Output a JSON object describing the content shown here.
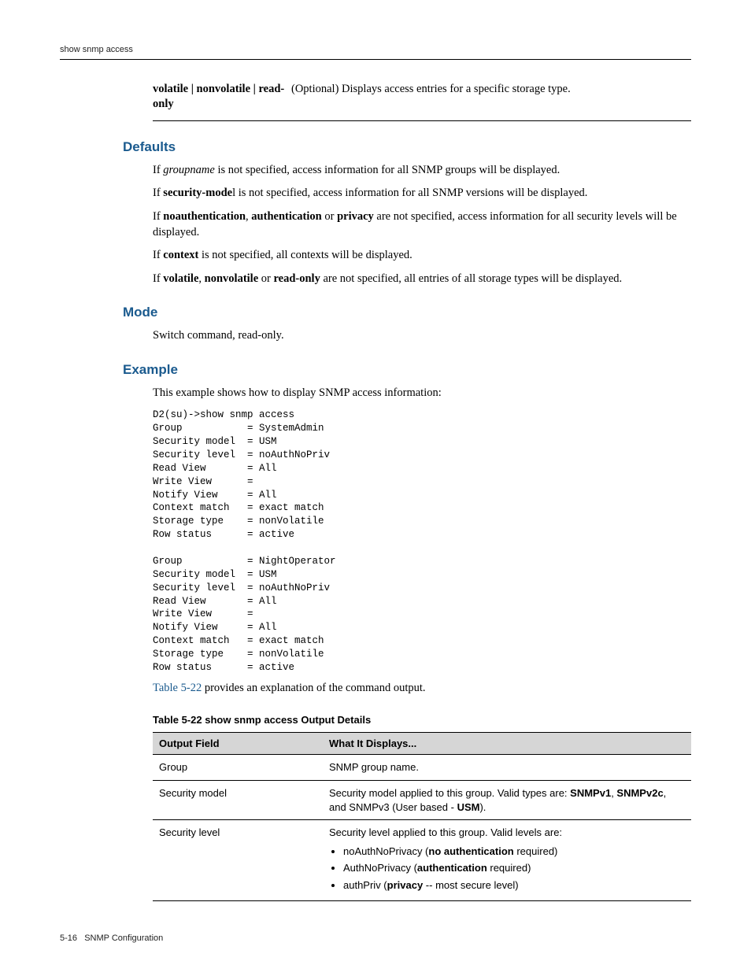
{
  "runningHead": "show snmp access",
  "param": {
    "name": "volatile | nonvolatile | read-only",
    "desc": "(Optional) Displays access entries for a specific storage type."
  },
  "sections": {
    "defaults": {
      "title": "Defaults",
      "p1a": "If ",
      "p1b": "groupname",
      "p1c": " is not specified, access information for all SNMP groups will be displayed.",
      "p2a": "If ",
      "p2b": "security-mode",
      "p2c": "l is not specified, access information for all SNMP versions will be displayed.",
      "p3a": "If ",
      "p3b": "noauthentication",
      "p3c": ", ",
      "p3d": "authentication",
      "p3e": " or ",
      "p3f": "privacy",
      "p3g": " are not specified, access information for all security levels will be displayed.",
      "p4a": "If ",
      "p4b": "context",
      "p4c": " is not specified, all contexts will be displayed.",
      "p5a": "If ",
      "p5b": "volatile",
      "p5c": ", ",
      "p5d": "nonvolatile",
      "p5e": " or ",
      "p5f": "read-only",
      "p5g": " are not specified, all entries of all storage types will be displayed."
    },
    "mode": {
      "title": "Mode",
      "p": "Switch command, read-only."
    },
    "example": {
      "title": "Example",
      "intro": "This example shows how to display SNMP access information:",
      "code": "D2(su)->show snmp access\nGroup           = SystemAdmin\nSecurity model  = USM\nSecurity level  = noAuthNoPriv\nRead View       = All\nWrite View      =\nNotify View     = All\nContext match   = exact match\nStorage type    = nonVolatile\nRow status      = active\n\nGroup           = NightOperator\nSecurity model  = USM\nSecurity level  = noAuthNoPriv\nRead View       = All\nWrite View      =\nNotify View     = All\nContext match   = exact match\nStorage type    = nonVolatile\nRow status      = active",
      "outroA": "Table 5-22",
      "outroB": " provides an explanation of the command output."
    }
  },
  "table": {
    "caption": "Table 5-22   show snmp access Output Details",
    "col1": "Output Field",
    "col2": "What It Displays...",
    "r1f": "Group",
    "r1d": "SNMP group name.",
    "r2f": "Security model",
    "r2a": "Security model applied to this group. Valid types are: ",
    "r2b": "SNMPv1",
    "r2c": ", ",
    "r2d": "SNMPv2c",
    "r2e": ", and SNMPv3 (User based - ",
    "r2f2": "USM",
    "r2g": ").",
    "r3f": "Security level",
    "r3intro": "Security level applied to this group. Valid levels are:",
    "r3li1a": "noAuthNoPrivacy (",
    "r3li1b": "no authentication",
    "r3li1c": " required)",
    "r3li2a": "AuthNoPrivacy (",
    "r3li2b": "authentication",
    "r3li2c": " required)",
    "r3li3a": "authPriv (",
    "r3li3b": "privacy",
    "r3li3c": " -- most secure level)"
  },
  "footer": {
    "page": "5-16",
    "chapter": "SNMP Configuration"
  }
}
